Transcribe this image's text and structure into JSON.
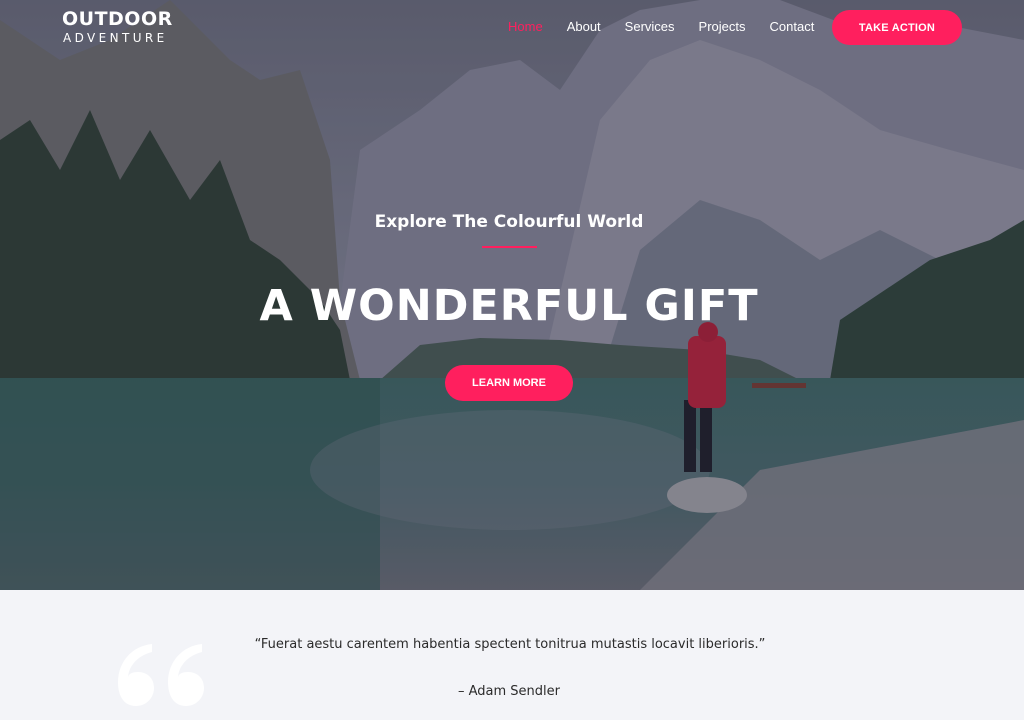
{
  "brand": {
    "line1": "OUTDOOR",
    "line2": "ADVENTURE"
  },
  "nav": {
    "items": [
      {
        "label": "Home",
        "active": true
      },
      {
        "label": "About",
        "active": false
      },
      {
        "label": "Services",
        "active": false
      },
      {
        "label": "Projects",
        "active": false
      },
      {
        "label": "Contact",
        "active": false
      }
    ],
    "cta_label": "TAKE ACTION"
  },
  "hero": {
    "subtitle": "Explore The Colourful World",
    "headline": "A WONDERFUL GIFT",
    "button_label": "LEARN MORE"
  },
  "testimonial": {
    "quote": "“Fuerat aestu carentem habentia spectent tonitrua mutastis locavit liberioris.”",
    "author": "– Adam Sendler"
  },
  "colors": {
    "accent": "#ff1f5e",
    "text_light": "#ffffff",
    "section_bg": "#f3f4f8",
    "body_text": "#2b2b2b"
  },
  "icons": [
    "quote-icon"
  ]
}
